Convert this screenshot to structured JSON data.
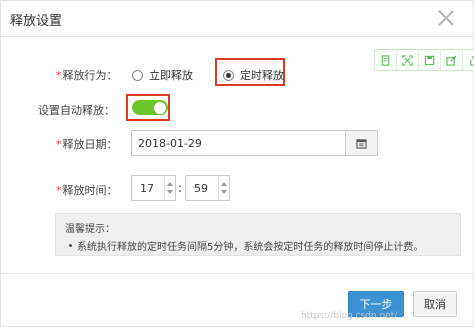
{
  "dialog": {
    "title": "释放设置"
  },
  "toolbar": {
    "icons": [
      "document-icon",
      "expand-icon",
      "save-icon",
      "edit-icon",
      "share-icon"
    ],
    "accent": "#5cb85c"
  },
  "form": {
    "release_action": {
      "star": "*",
      "label": "释放行为：",
      "options": [
        {
          "label": "立即释放",
          "checked": false
        },
        {
          "label": "定时释放",
          "checked": true
        }
      ]
    },
    "auto_release": {
      "label": "设置自动释放：",
      "enabled": true,
      "color": "#6cc52a"
    },
    "release_date": {
      "star": "*",
      "label": "释放日期：",
      "value": "2018-01-29"
    },
    "release_time": {
      "star": "*",
      "label": "释放时间：",
      "hour": "17",
      "separator": ":",
      "minute": "59"
    }
  },
  "tip": {
    "title": "温馨提示：",
    "lines": [
      "系统执行释放的定时任务间隔5分钟，系统会按定时任务的释放时间停止计费。"
    ]
  },
  "footer": {
    "next_label": "下一步",
    "cancel_label": "取消",
    "primary_color": "#3d92d4"
  },
  "watermark": "https://blog.csdn.net/..."
}
